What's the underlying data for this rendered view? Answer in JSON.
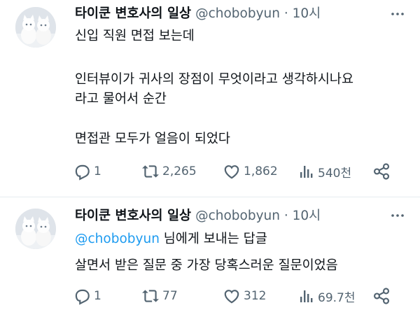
{
  "tweets": [
    {
      "author": {
        "name": "타이쿤 변호사의 일상",
        "handle": "@chobobyun",
        "time": "10시"
      },
      "lines": [
        "신입 직원 면접 보는데",
        "인터뷰이가 귀사의 장점이 무엇이라고 생각하시나요",
        "라고 물어서 순간",
        "면접관 모두가 얼음이 되었다"
      ],
      "metrics": {
        "replies": "1",
        "retweets": "2,265",
        "likes": "1,862",
        "views": "540천"
      }
    },
    {
      "author": {
        "name": "타이쿤 변호사의 일상",
        "handle": "@chobobyun",
        "time": "10시"
      },
      "reply_to": {
        "mention": "@chobobyun",
        "suffix": " 님에게 보내는 답글"
      },
      "lines": [
        "살면서 받은 질문 중 가장 당혹스러운 질문이었음"
      ],
      "metrics": {
        "replies": "1",
        "retweets": "77",
        "likes": "312",
        "views": "69.7천"
      }
    }
  ],
  "icons": [
    "avatar-cats-icon",
    "more-icon",
    "reply-icon",
    "retweet-icon",
    "like-icon",
    "views-icon",
    "share-icon"
  ],
  "colors": {
    "text": "#0f1419",
    "secondary": "#536471",
    "accent": "#1d9bf0",
    "divider": "#e6ecf0"
  }
}
